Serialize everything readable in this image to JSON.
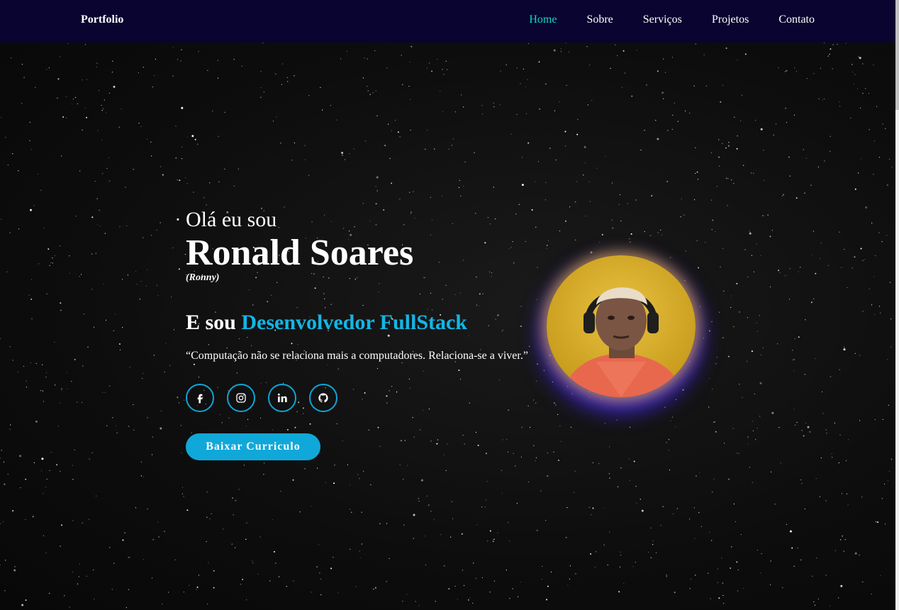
{
  "header": {
    "logo": "Portfolio",
    "nav": [
      {
        "label": "Home",
        "active": true
      },
      {
        "label": "Sobre",
        "active": false
      },
      {
        "label": "Serviços",
        "active": false
      },
      {
        "label": "Projetos",
        "active": false
      },
      {
        "label": "Contato",
        "active": false
      }
    ]
  },
  "hero": {
    "greeting": "Olá eu sou",
    "name": "Ronald Soares",
    "nickname": "(Ronny)",
    "role_prefix": "E sou",
    "role_highlight": "Desenvolvedor FullStack",
    "quote": "“Computação não se relaciona mais a computadores. Relaciona-se a viver.”",
    "socials": [
      {
        "name": "facebook",
        "icon": "facebook-icon"
      },
      {
        "name": "instagram",
        "icon": "instagram-icon"
      },
      {
        "name": "linkedin",
        "icon": "linkedin-icon"
      },
      {
        "name": "github",
        "icon": "github-icon"
      }
    ],
    "button_label": "Baixar Curriculo"
  },
  "colors": {
    "header_bg": "#090430",
    "accent_nav_active": "#12d6c6",
    "accent_role": "#13b6e6",
    "button_bg": "#10a8d8",
    "avatar_glow_top": "#ffc828",
    "avatar_glow_bottom": "#4628ff"
  }
}
